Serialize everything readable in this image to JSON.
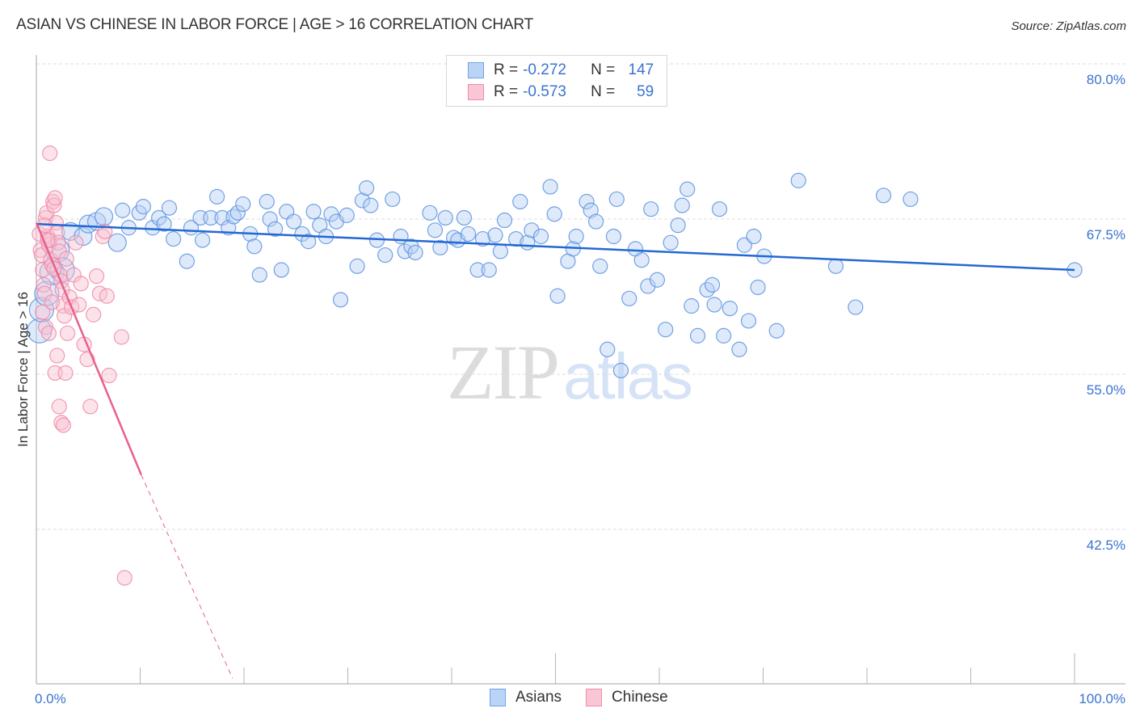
{
  "chart_data": {
    "type": "scatter",
    "title": "ASIAN VS CHINESE IN LABOR FORCE | AGE > 16 CORRELATION CHART",
    "source": "Source: ZipAtlas.com",
    "xlabel": "",
    "ylabel": "In Labor Force | Age > 16",
    "xlim": [
      0,
      100
    ],
    "ylim": [
      29,
      82
    ],
    "x_tick_labels": [
      "0.0%",
      "100.0%"
    ],
    "y_ticks": [
      80.0,
      67.5,
      55.0,
      42.5
    ],
    "y_tick_labels": [
      "80.0%",
      "67.5%",
      "55.0%",
      "42.5%"
    ],
    "grid": true,
    "legend_position": "top-center",
    "watermark": {
      "part1": "ZIP",
      "part2": "atlas"
    },
    "colors": {
      "asians": "#6fa3e6",
      "asians_line": "#2468d4",
      "chinese": "#f28aa8",
      "chinese_line": "#e8608e",
      "tick_text": "#3a73d0"
    },
    "series": [
      {
        "name": "Asians",
        "R": "-0.272",
        "N": "147",
        "trend": {
          "x0": 0,
          "y0": 67.1,
          "x1": 100,
          "y1": 63.4
        },
        "points": [
          [
            0.3,
            58.5
          ],
          [
            0.5,
            60.2
          ],
          [
            1.0,
            61.5
          ],
          [
            1.5,
            63.2
          ],
          [
            2.0,
            65.0
          ],
          [
            2.5,
            63.4
          ],
          [
            3.3,
            66.5
          ],
          [
            4.5,
            66.1
          ],
          [
            5.0,
            67.1
          ],
          [
            5.8,
            67.3
          ],
          [
            6.5,
            67.7
          ],
          [
            7.8,
            65.6
          ],
          [
            8.3,
            68.2
          ],
          [
            8.9,
            66.8
          ],
          [
            9.9,
            68.0
          ],
          [
            10.3,
            68.5
          ],
          [
            11.2,
            66.8
          ],
          [
            11.8,
            67.6
          ],
          [
            12.3,
            67.1
          ],
          [
            12.8,
            68.4
          ],
          [
            13.2,
            65.9
          ],
          [
            14.5,
            64.1
          ],
          [
            14.9,
            66.8
          ],
          [
            15.8,
            67.6
          ],
          [
            16.0,
            65.8
          ],
          [
            16.8,
            67.6
          ],
          [
            17.4,
            69.3
          ],
          [
            17.9,
            67.6
          ],
          [
            18.5,
            66.8
          ],
          [
            19.0,
            67.7
          ],
          [
            19.4,
            68.0
          ],
          [
            19.9,
            68.7
          ],
          [
            20.6,
            66.3
          ],
          [
            21.0,
            65.3
          ],
          [
            21.5,
            63.0
          ],
          [
            22.2,
            68.9
          ],
          [
            22.5,
            67.5
          ],
          [
            23.0,
            66.7
          ],
          [
            23.6,
            63.4
          ],
          [
            24.1,
            68.1
          ],
          [
            24.8,
            67.3
          ],
          [
            25.6,
            66.3
          ],
          [
            26.2,
            65.7
          ],
          [
            26.7,
            68.1
          ],
          [
            27.3,
            67.0
          ],
          [
            27.9,
            66.1
          ],
          [
            28.4,
            67.9
          ],
          [
            28.9,
            67.3
          ],
          [
            29.3,
            61.0
          ],
          [
            29.9,
            67.8
          ],
          [
            30.9,
            63.7
          ],
          [
            31.4,
            69.0
          ],
          [
            31.8,
            70.0
          ],
          [
            32.2,
            68.6
          ],
          [
            32.8,
            65.8
          ],
          [
            33.6,
            64.6
          ],
          [
            34.3,
            69.1
          ],
          [
            35.1,
            66.1
          ],
          [
            35.5,
            64.9
          ],
          [
            36.1,
            65.3
          ],
          [
            36.5,
            64.8
          ],
          [
            37.9,
            68.0
          ],
          [
            38.4,
            66.6
          ],
          [
            38.9,
            65.2
          ],
          [
            39.4,
            67.6
          ],
          [
            40.2,
            66.0
          ],
          [
            40.6,
            65.8
          ],
          [
            41.2,
            67.6
          ],
          [
            41.6,
            66.3
          ],
          [
            42.5,
            63.4
          ],
          [
            43.0,
            65.9
          ],
          [
            43.6,
            63.4
          ],
          [
            44.2,
            66.2
          ],
          [
            44.7,
            64.9
          ],
          [
            45.1,
            67.4
          ],
          [
            46.2,
            65.9
          ],
          [
            46.6,
            68.9
          ],
          [
            47.3,
            65.6
          ],
          [
            47.7,
            66.6
          ],
          [
            48.6,
            66.1
          ],
          [
            49.5,
            70.1
          ],
          [
            49.9,
            67.9
          ],
          [
            50.2,
            61.3
          ],
          [
            51.2,
            64.1
          ],
          [
            51.7,
            65.1
          ],
          [
            52.0,
            66.1
          ],
          [
            53.0,
            68.9
          ],
          [
            53.4,
            68.2
          ],
          [
            53.9,
            67.3
          ],
          [
            54.3,
            63.7
          ],
          [
            55.0,
            57.0
          ],
          [
            55.6,
            66.1
          ],
          [
            55.9,
            69.1
          ],
          [
            56.3,
            55.3
          ],
          [
            57.1,
            61.1
          ],
          [
            57.7,
            65.1
          ],
          [
            58.3,
            64.2
          ],
          [
            58.9,
            62.1
          ],
          [
            59.2,
            68.3
          ],
          [
            59.8,
            62.6
          ],
          [
            60.6,
            58.6
          ],
          [
            61.1,
            65.6
          ],
          [
            61.8,
            67.0
          ],
          [
            62.2,
            68.6
          ],
          [
            62.7,
            69.9
          ],
          [
            63.1,
            60.5
          ],
          [
            63.7,
            58.1
          ],
          [
            64.6,
            61.8
          ],
          [
            65.1,
            62.2
          ],
          [
            65.3,
            60.6
          ],
          [
            65.8,
            68.3
          ],
          [
            66.2,
            58.1
          ],
          [
            66.8,
            60.3
          ],
          [
            67.7,
            57.0
          ],
          [
            68.2,
            65.4
          ],
          [
            68.6,
            59.3
          ],
          [
            69.1,
            66.1
          ],
          [
            69.5,
            62.0
          ],
          [
            70.1,
            64.5
          ],
          [
            71.3,
            58.5
          ],
          [
            73.4,
            70.6
          ],
          [
            77.0,
            63.7
          ],
          [
            78.9,
            60.4
          ],
          [
            81.6,
            69.4
          ],
          [
            84.2,
            69.1
          ],
          [
            100.0,
            63.4
          ]
        ]
      },
      {
        "name": "Chinese",
        "R": "-0.573",
        "N": "59",
        "trend": {
          "x0": 0,
          "y0": 67.2,
          "x1": 10.1,
          "y1": 46.9,
          "dashed_to_x": 18.9,
          "dashed_to_y": 30.5
        },
        "points": [
          [
            0.3,
            66.3
          ],
          [
            0.4,
            65.0
          ],
          [
            0.5,
            64.6
          ],
          [
            0.6,
            63.4
          ],
          [
            0.7,
            62.2
          ],
          [
            0.8,
            61.5
          ],
          [
            0.9,
            67.6
          ],
          [
            1.0,
            68.0
          ],
          [
            1.1,
            66.1
          ],
          [
            1.2,
            65.4
          ],
          [
            1.3,
            65.8
          ],
          [
            1.4,
            64.2
          ],
          [
            1.5,
            63.8
          ],
          [
            1.6,
            68.9
          ],
          [
            1.7,
            68.6
          ],
          [
            1.8,
            69.2
          ],
          [
            1.9,
            67.2
          ],
          [
            2.0,
            66.4
          ],
          [
            2.1,
            65.6
          ],
          [
            2.2,
            64.9
          ],
          [
            2.3,
            63.0
          ],
          [
            2.4,
            62.5
          ],
          [
            2.5,
            61.8
          ],
          [
            2.6,
            60.5
          ],
          [
            2.7,
            59.7
          ],
          [
            0.6,
            60.0
          ],
          [
            0.9,
            58.8
          ],
          [
            1.2,
            58.3
          ],
          [
            1.3,
            72.8
          ],
          [
            1.5,
            60.8
          ],
          [
            1.8,
            55.1
          ],
          [
            2.0,
            56.5
          ],
          [
            2.2,
            52.4
          ],
          [
            2.4,
            51.1
          ],
          [
            2.6,
            50.9
          ],
          [
            2.8,
            55.1
          ],
          [
            3.0,
            58.3
          ],
          [
            3.2,
            61.2
          ],
          [
            3.4,
            60.4
          ],
          [
            3.6,
            63.0
          ],
          [
            3.8,
            65.6
          ],
          [
            4.1,
            60.6
          ],
          [
            4.3,
            62.3
          ],
          [
            4.6,
            57.4
          ],
          [
            4.9,
            56.2
          ],
          [
            5.2,
            52.4
          ],
          [
            5.5,
            59.8
          ],
          [
            5.8,
            62.9
          ],
          [
            6.1,
            61.5
          ],
          [
            6.4,
            66.1
          ],
          [
            6.6,
            66.5
          ],
          [
            6.8,
            61.3
          ],
          [
            7.0,
            54.9
          ],
          [
            8.2,
            58.0
          ],
          [
            8.5,
            38.6
          ],
          [
            1.1,
            65.8
          ],
          [
            1.7,
            63.5
          ],
          [
            0.8,
            67.0
          ],
          [
            2.9,
            64.3
          ]
        ]
      }
    ]
  }
}
